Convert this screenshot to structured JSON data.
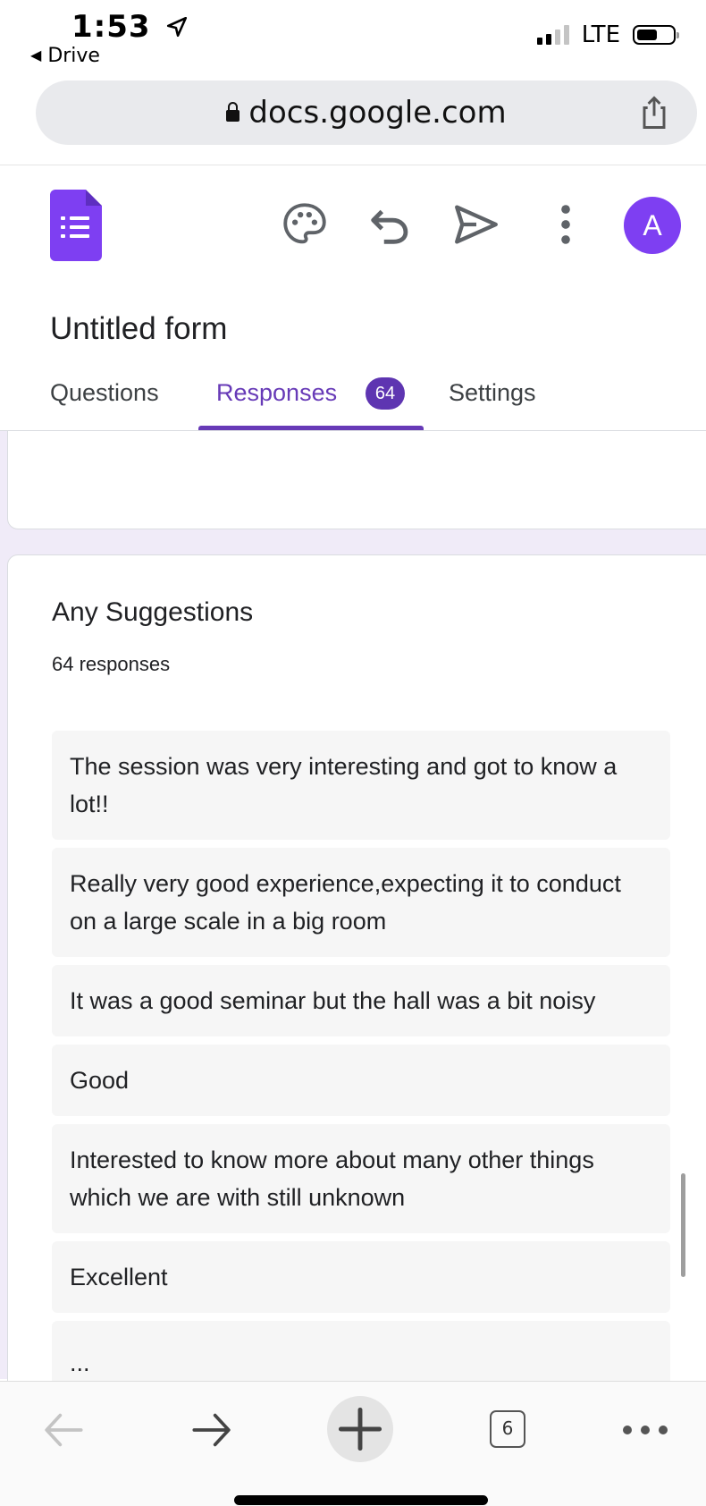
{
  "status_bar": {
    "time": "1:53",
    "back_app": "Drive",
    "network": "LTE"
  },
  "browser": {
    "url": "docs.google.com",
    "tab_count": "6"
  },
  "forms_header": {
    "avatar_letter": "A",
    "form_title": "Untitled form"
  },
  "tabs": [
    {
      "label": "Questions",
      "active": false
    },
    {
      "label": "Responses",
      "active": true,
      "badge": "64"
    },
    {
      "label": "Settings",
      "active": false
    }
  ],
  "question": {
    "title": "Any Suggestions",
    "count": "64 responses",
    "responses": [
      "The session was very interesting and got to know a lot!!",
      "Really very good experience,expecting it to conduct on a large scale in a big room",
      "It was a good seminar but the hall was a bit noisy",
      "Good",
      "Interested to know more about many other things which we are with still unknown",
      "Excellent",
      "..."
    ]
  },
  "colors": {
    "accent": "#673ab7",
    "forms_purple": "#7e3ff2",
    "content_bg": "#f0ebf8",
    "response_bg": "#f6f6f6"
  },
  "icons": {
    "status": [
      "location-arrow-icon",
      "signal-icon",
      "battery-icon"
    ],
    "browser": [
      "lock-icon",
      "share-icon"
    ],
    "header": [
      "forms-logo-icon",
      "palette-icon",
      "undo-icon",
      "send-icon",
      "more-vert-icon"
    ],
    "toolbar": [
      "back-arrow-icon",
      "forward-arrow-icon",
      "new-tab-icon",
      "tabs-icon",
      "more-horiz-icon"
    ]
  }
}
